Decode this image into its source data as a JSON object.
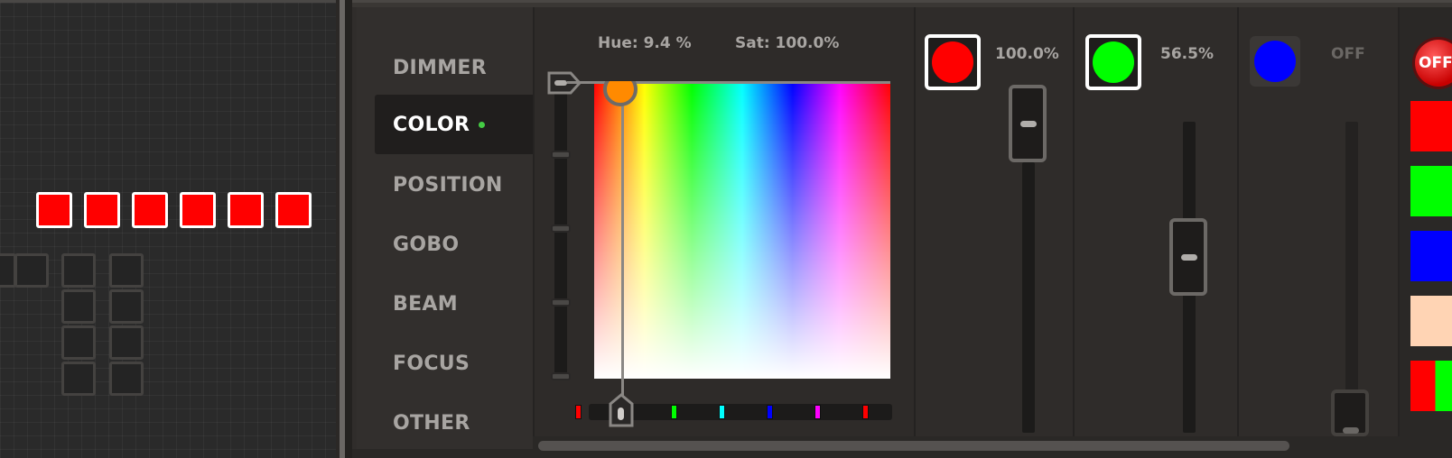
{
  "categories": [
    {
      "label": "DIMMER",
      "active": false
    },
    {
      "label": "COLOR",
      "active": true
    },
    {
      "label": "POSITION",
      "active": false
    },
    {
      "label": "GOBO",
      "active": false
    },
    {
      "label": "BEAM",
      "active": false
    },
    {
      "label": "FOCUS",
      "active": false
    },
    {
      "label": "OTHER",
      "active": false
    }
  ],
  "picker": {
    "hue_label": "Hue: 9.4  %",
    "sat_label": "Sat: 100.0%"
  },
  "channels": [
    {
      "name": "red",
      "color": "#ff0000",
      "value_text": "100.0%",
      "level": 1.0,
      "selected": true
    },
    {
      "name": "green",
      "color": "#00ff00",
      "value_text": "56.5%",
      "level": 0.565,
      "selected": true
    },
    {
      "name": "blue",
      "color": "#0000ff",
      "value_text": "OFF",
      "level": 0.0,
      "selected": false
    }
  ],
  "presets": {
    "off_label": "OFF",
    "swatches": [
      "#ff0000",
      "#00ff00",
      "#0000ff",
      "#ffd4b4",
      "split-red-green"
    ]
  },
  "hue_markers": [
    "#ff0000",
    "#ffff00",
    "#00ff00",
    "#00ffff",
    "#0000ff",
    "#ff00ff",
    "#ff0000"
  ],
  "fixture_grid": {
    "selected_count": 6,
    "selected_color": "#ff0000"
  }
}
